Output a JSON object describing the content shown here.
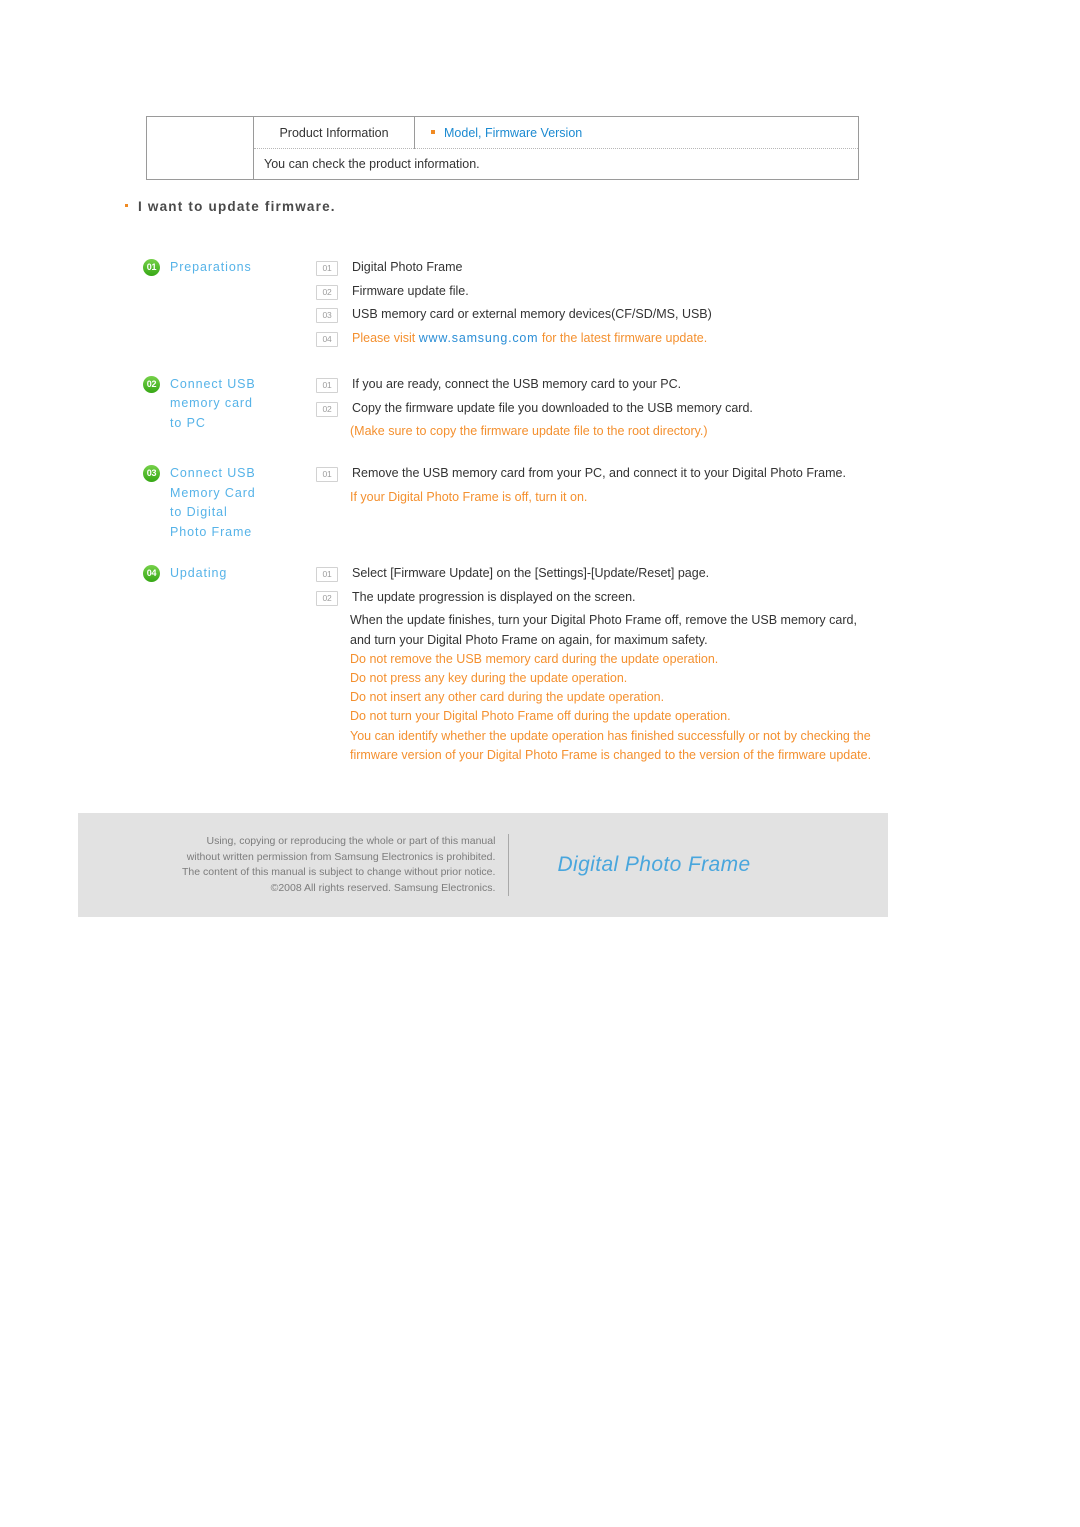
{
  "info_table": {
    "label": "Product Information",
    "value": "Model, Firmware Version",
    "description": "You can check the product information.",
    "bullet_color": "#f08a22",
    "value_color": "#1c8ad1"
  },
  "heading": {
    "text": "I want to update firmware.",
    "bullet_color": "#f08a22"
  },
  "colors": {
    "badge_green": "#4cb82a",
    "step_title_blue": "#56b3e8",
    "warning_orange": "#f4902f",
    "link_blue": "#2b8ed6",
    "footer_bg": "#e2e2e2",
    "footer_logo_blue": "#49a6dd"
  },
  "steps": [
    {
      "badge": "01",
      "title": "Preparations",
      "items": [
        {
          "num": "01",
          "text": "Digital Photo Frame",
          "style": "plain"
        },
        {
          "num": "02",
          "text": "Firmware update file.",
          "style": "plain"
        },
        {
          "num": "03",
          "text": "USB memory card or external memory devices(CF/SD/MS, USB)",
          "style": "plain"
        },
        {
          "num": "04",
          "text": "Please visit www.samsung.com for the latest firmware update.",
          "style": "orange-with-link",
          "link_text": "www.samsung.com",
          "pre_link": "Please visit ",
          "post_link": " for the latest firmware update."
        }
      ],
      "extra": []
    },
    {
      "badge": "02",
      "title": "Connect USB memory card to PC",
      "title_lines": [
        "Connect USB",
        "memory card",
        "to PC"
      ],
      "items": [
        {
          "num": "01",
          "text": "If you are ready, connect the USB memory card to your PC.",
          "style": "plain"
        },
        {
          "num": "02",
          "text": "Copy the firmware update file you downloaded to the USB memory card.",
          "style": "plain"
        }
      ],
      "extra": [
        {
          "text": "(Make sure to copy the firmware update file to the root directory.)",
          "style": "orange"
        }
      ]
    },
    {
      "badge": "03",
      "title": "Connect USB Memory Card to Digital Photo Frame",
      "title_lines": [
        "Connect USB",
        "Memory Card",
        "to Digital",
        "Photo Frame"
      ],
      "items": [
        {
          "num": "01",
          "text": "Remove the USB memory card from your PC, and connect it to your Digital Photo Frame.",
          "style": "plain"
        }
      ],
      "extra": [
        {
          "text": "If your Digital Photo Frame is off, turn it on.",
          "style": "orange"
        }
      ]
    },
    {
      "badge": "04",
      "title": "Updating",
      "title_lines": [
        "Updating"
      ],
      "items": [
        {
          "num": "01",
          "text": "Select [Firmware Update] on the [Settings]-[Update/Reset] page.",
          "style": "plain"
        },
        {
          "num": "02",
          "text": "The update progression is displayed on the screen.",
          "style": "plain"
        }
      ],
      "continuation": [
        "When the update finishes, turn your Digital Photo Frame off, remove the USB memory card,",
        "and turn your Digital Photo Frame on again, for maximum safety."
      ],
      "warnings": [
        "Do not remove the USB memory card during the update operation.",
        "Do not press any key during the update operation.",
        "Do not insert any other card during the update operation.",
        "Do not turn your Digital Photo Frame off during the update operation.",
        "You can identify whether the update operation has finished successfully or not by checking the",
        "firmware version of your Digital Photo Frame is changed to the version of the firmware update."
      ]
    }
  ],
  "footer": {
    "lines": [
      "Using, copying or reproducing the whole or part of this manual",
      "without written permission from Samsung Electronics  is prohibited.",
      "The content of this manual is subject to change without prior notice.",
      "©2008 All rights reserved. Samsung Electronics."
    ],
    "logo": "Digital Photo Frame"
  }
}
